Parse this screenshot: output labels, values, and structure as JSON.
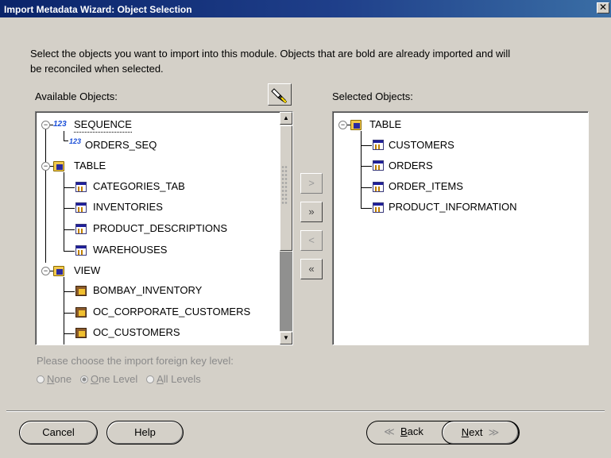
{
  "window": {
    "title": "Import Metadata Wizard: Object Selection",
    "close_glyph": "✕"
  },
  "instructions": {
    "line1": "Select the objects you want to import into this module. Objects that are bold are already imported and will",
    "line2": "be reconciled when selected."
  },
  "available": {
    "label": "Available Objects:",
    "groups": [
      {
        "name": "SEQUENCE",
        "icon": "sequence-folder-icon",
        "expanded": true,
        "items": [
          {
            "name": "ORDERS_SEQ",
            "icon": "sequence-icon"
          }
        ]
      },
      {
        "name": "TABLE",
        "icon": "table-folder-icon",
        "expanded": true,
        "items": [
          {
            "name": "CATEGORIES_TAB",
            "icon": "table-icon"
          },
          {
            "name": "INVENTORIES",
            "icon": "table-icon"
          },
          {
            "name": "PRODUCT_DESCRIPTIONS",
            "icon": "table-icon"
          },
          {
            "name": "WAREHOUSES",
            "icon": "table-icon"
          }
        ]
      },
      {
        "name": "VIEW",
        "icon": "view-folder-icon",
        "expanded": true,
        "items": [
          {
            "name": "BOMBAY_INVENTORY",
            "icon": "view-icon"
          },
          {
            "name": "OC_CORPORATE_CUSTOMERS",
            "icon": "view-icon"
          },
          {
            "name": "OC_CUSTOMERS",
            "icon": "view-icon"
          }
        ]
      }
    ],
    "scroll_position": 0.0
  },
  "selected": {
    "label": "Selected Objects:",
    "groups": [
      {
        "name": "TABLE",
        "icon": "table-folder-icon",
        "expanded": true,
        "items": [
          {
            "name": "CUSTOMERS",
            "icon": "table-icon"
          },
          {
            "name": "ORDERS",
            "icon": "table-icon"
          },
          {
            "name": "ORDER_ITEMS",
            "icon": "table-icon"
          },
          {
            "name": "PRODUCT_INFORMATION",
            "icon": "table-icon"
          }
        ]
      }
    ]
  },
  "transfer_buttons": {
    "add_one": ">",
    "add_all": "»",
    "remove_one": "<",
    "remove_all": "«"
  },
  "foreign_key": {
    "prompt": "Please choose the import foreign key level:",
    "options": [
      {
        "label": "None",
        "mnemonic": "N",
        "rest": "one",
        "selected": false
      },
      {
        "label": "One Level",
        "mnemonic": "O",
        "rest": "ne Level",
        "selected": true
      },
      {
        "label": "All Levels",
        "mnemonic": "A",
        "rest": "ll Levels",
        "selected": false
      }
    ],
    "enabled": false
  },
  "buttons": {
    "cancel": "Cancel",
    "help": "Help",
    "back_mnemonic": "B",
    "back_rest": "ack",
    "back_glyph": "≪",
    "next_mnemonic": "N",
    "next_rest": "ext",
    "next_glyph": "≫"
  },
  "colors": {
    "titlebar": "#0a246a",
    "dialog_bg": "#d4d0c8",
    "tree_bg": "#ffffff",
    "disabled_text": "#8a8a8a"
  }
}
